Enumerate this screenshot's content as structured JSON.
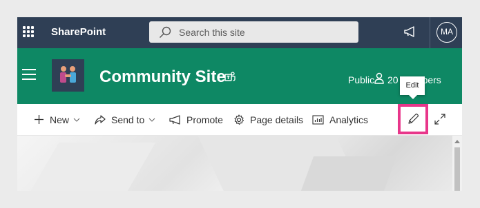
{
  "suite_bar": {
    "app_name": "SharePoint",
    "search_placeholder": "Search this site",
    "avatar_initials": "MA"
  },
  "site_header": {
    "title": "Community Site",
    "privacy": "Public",
    "members": "20 members"
  },
  "tooltip": {
    "text": "Edit"
  },
  "command_bar": {
    "new_label": "New",
    "send_to_label": "Send to",
    "promote_label": "Promote",
    "page_details_label": "Page details",
    "analytics_label": "Analytics"
  },
  "colors": {
    "suite_bar": "#2f3f55",
    "site_header": "#0e8864",
    "highlight": "#e8368a"
  }
}
